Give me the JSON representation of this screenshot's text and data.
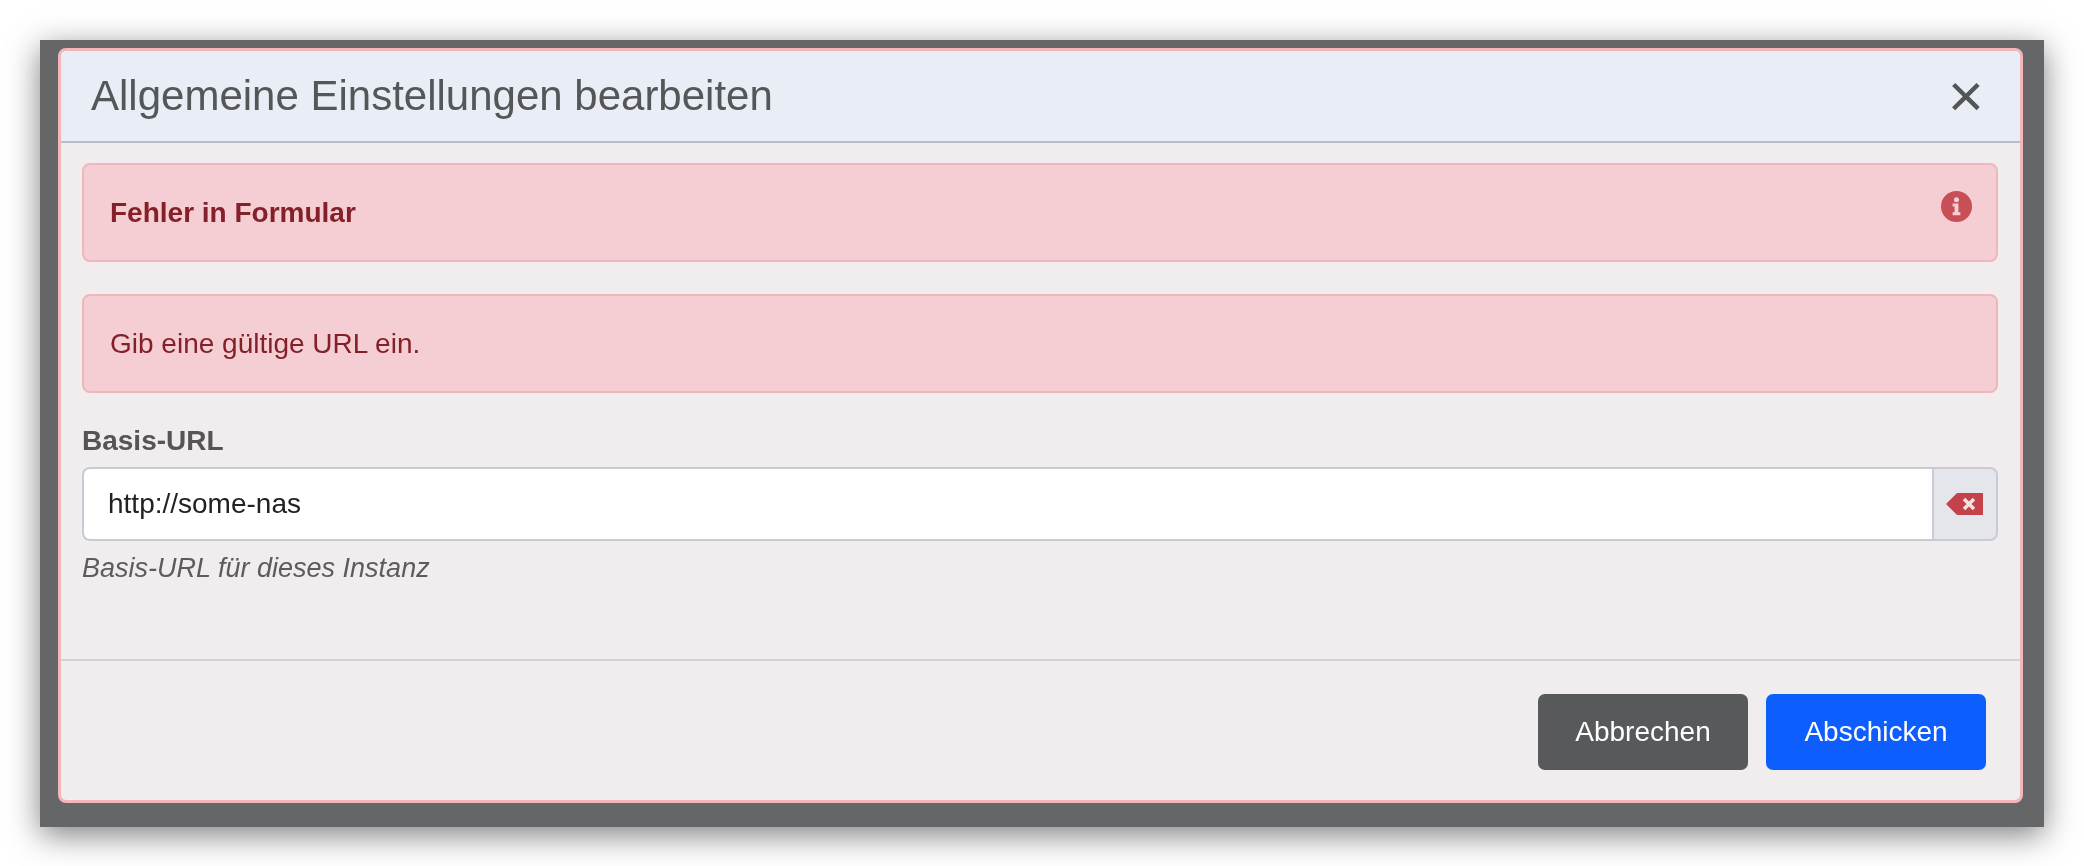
{
  "dialog": {
    "title": "Allgemeine Einstellungen bearbeiten",
    "close": "×"
  },
  "alerts": [
    {
      "kind": "heading",
      "text": "Fehler in Formular"
    },
    {
      "kind": "message",
      "text": "Gib eine gültige URL ein."
    }
  ],
  "field": {
    "label": "Basis-URL",
    "value": "http://some-nas",
    "help": "Basis-URL für dieses Instanz"
  },
  "buttons": [
    {
      "label": "Abbrechen",
      "kind": "secondary"
    },
    {
      "label": "Abschicken",
      "kind": "primary"
    }
  ]
}
